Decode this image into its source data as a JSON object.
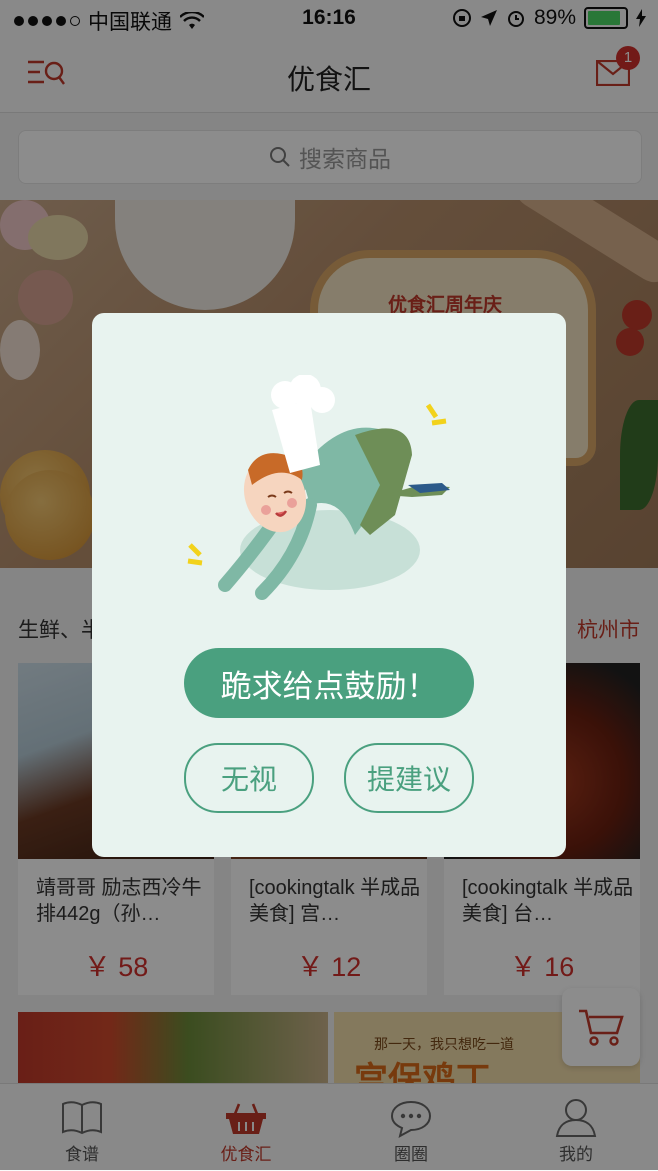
{
  "status_bar": {
    "carrier": "中国联通",
    "time": "16:16",
    "battery": "89%",
    "battery_level": 0.89
  },
  "navbar": {
    "title": "优食汇",
    "message_count": "1"
  },
  "search": {
    "placeholder": "搜索商品"
  },
  "banner": {
    "text": "优食汇周年庆"
  },
  "section": {
    "title": "生鲜、半",
    "city": "杭州市"
  },
  "products": [
    {
      "name": "靖哥哥 励志西冷牛排442g（孙…",
      "price": "￥ 58"
    },
    {
      "name": "[cookingtalk 半成品美食] 宫…",
      "price": "￥ 12"
    },
    {
      "name": "[cookingtalk 半成品美食] 台…",
      "price": "￥ 16"
    }
  ],
  "row2_banner_text": "那一天，我只想吃一道",
  "row2_banner_big": "宫保鸡丁",
  "tabs": [
    {
      "label": "食谱",
      "icon": "book-icon"
    },
    {
      "label": "优食汇",
      "icon": "basket-icon"
    },
    {
      "label": "圈圈",
      "icon": "chat-icon"
    },
    {
      "label": "我的",
      "icon": "user-icon"
    }
  ],
  "dialog": {
    "main_button": "跪求给点鼓励！",
    "ignore_button": "无视",
    "suggest_button": "提建议"
  },
  "colors": {
    "brand_red": "#d0312d",
    "dialog_green": "#4aa07f",
    "dialog_bg": "#e8f3ef"
  }
}
